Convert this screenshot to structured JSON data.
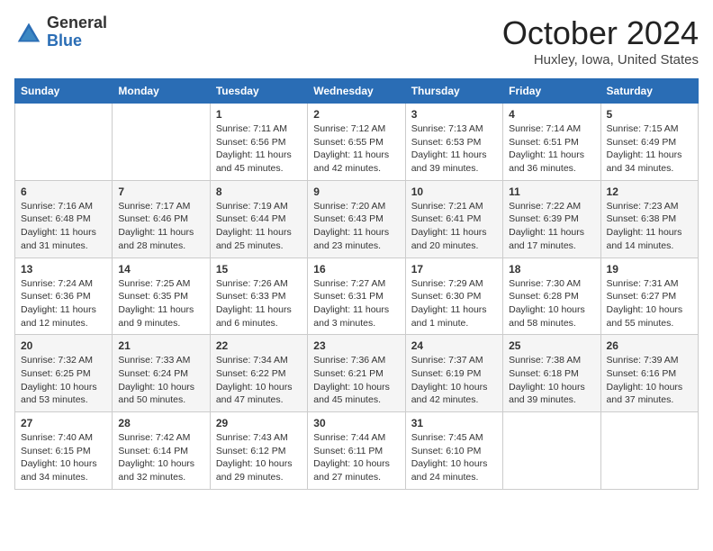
{
  "header": {
    "logo_general": "General",
    "logo_blue": "Blue",
    "month_title": "October 2024",
    "location": "Huxley, Iowa, United States"
  },
  "days_of_week": [
    "Sunday",
    "Monday",
    "Tuesday",
    "Wednesday",
    "Thursday",
    "Friday",
    "Saturday"
  ],
  "weeks": [
    [
      {
        "day": "",
        "info": ""
      },
      {
        "day": "",
        "info": ""
      },
      {
        "day": "1",
        "info": "Sunrise: 7:11 AM\nSunset: 6:56 PM\nDaylight: 11 hours and 45 minutes."
      },
      {
        "day": "2",
        "info": "Sunrise: 7:12 AM\nSunset: 6:55 PM\nDaylight: 11 hours and 42 minutes."
      },
      {
        "day": "3",
        "info": "Sunrise: 7:13 AM\nSunset: 6:53 PM\nDaylight: 11 hours and 39 minutes."
      },
      {
        "day": "4",
        "info": "Sunrise: 7:14 AM\nSunset: 6:51 PM\nDaylight: 11 hours and 36 minutes."
      },
      {
        "day": "5",
        "info": "Sunrise: 7:15 AM\nSunset: 6:49 PM\nDaylight: 11 hours and 34 minutes."
      }
    ],
    [
      {
        "day": "6",
        "info": "Sunrise: 7:16 AM\nSunset: 6:48 PM\nDaylight: 11 hours and 31 minutes."
      },
      {
        "day": "7",
        "info": "Sunrise: 7:17 AM\nSunset: 6:46 PM\nDaylight: 11 hours and 28 minutes."
      },
      {
        "day": "8",
        "info": "Sunrise: 7:19 AM\nSunset: 6:44 PM\nDaylight: 11 hours and 25 minutes."
      },
      {
        "day": "9",
        "info": "Sunrise: 7:20 AM\nSunset: 6:43 PM\nDaylight: 11 hours and 23 minutes."
      },
      {
        "day": "10",
        "info": "Sunrise: 7:21 AM\nSunset: 6:41 PM\nDaylight: 11 hours and 20 minutes."
      },
      {
        "day": "11",
        "info": "Sunrise: 7:22 AM\nSunset: 6:39 PM\nDaylight: 11 hours and 17 minutes."
      },
      {
        "day": "12",
        "info": "Sunrise: 7:23 AM\nSunset: 6:38 PM\nDaylight: 11 hours and 14 minutes."
      }
    ],
    [
      {
        "day": "13",
        "info": "Sunrise: 7:24 AM\nSunset: 6:36 PM\nDaylight: 11 hours and 12 minutes."
      },
      {
        "day": "14",
        "info": "Sunrise: 7:25 AM\nSunset: 6:35 PM\nDaylight: 11 hours and 9 minutes."
      },
      {
        "day": "15",
        "info": "Sunrise: 7:26 AM\nSunset: 6:33 PM\nDaylight: 11 hours and 6 minutes."
      },
      {
        "day": "16",
        "info": "Sunrise: 7:27 AM\nSunset: 6:31 PM\nDaylight: 11 hours and 3 minutes."
      },
      {
        "day": "17",
        "info": "Sunrise: 7:29 AM\nSunset: 6:30 PM\nDaylight: 11 hours and 1 minute."
      },
      {
        "day": "18",
        "info": "Sunrise: 7:30 AM\nSunset: 6:28 PM\nDaylight: 10 hours and 58 minutes."
      },
      {
        "day": "19",
        "info": "Sunrise: 7:31 AM\nSunset: 6:27 PM\nDaylight: 10 hours and 55 minutes."
      }
    ],
    [
      {
        "day": "20",
        "info": "Sunrise: 7:32 AM\nSunset: 6:25 PM\nDaylight: 10 hours and 53 minutes."
      },
      {
        "day": "21",
        "info": "Sunrise: 7:33 AM\nSunset: 6:24 PM\nDaylight: 10 hours and 50 minutes."
      },
      {
        "day": "22",
        "info": "Sunrise: 7:34 AM\nSunset: 6:22 PM\nDaylight: 10 hours and 47 minutes."
      },
      {
        "day": "23",
        "info": "Sunrise: 7:36 AM\nSunset: 6:21 PM\nDaylight: 10 hours and 45 minutes."
      },
      {
        "day": "24",
        "info": "Sunrise: 7:37 AM\nSunset: 6:19 PM\nDaylight: 10 hours and 42 minutes."
      },
      {
        "day": "25",
        "info": "Sunrise: 7:38 AM\nSunset: 6:18 PM\nDaylight: 10 hours and 39 minutes."
      },
      {
        "day": "26",
        "info": "Sunrise: 7:39 AM\nSunset: 6:16 PM\nDaylight: 10 hours and 37 minutes."
      }
    ],
    [
      {
        "day": "27",
        "info": "Sunrise: 7:40 AM\nSunset: 6:15 PM\nDaylight: 10 hours and 34 minutes."
      },
      {
        "day": "28",
        "info": "Sunrise: 7:42 AM\nSunset: 6:14 PM\nDaylight: 10 hours and 32 minutes."
      },
      {
        "day": "29",
        "info": "Sunrise: 7:43 AM\nSunset: 6:12 PM\nDaylight: 10 hours and 29 minutes."
      },
      {
        "day": "30",
        "info": "Sunrise: 7:44 AM\nSunset: 6:11 PM\nDaylight: 10 hours and 27 minutes."
      },
      {
        "day": "31",
        "info": "Sunrise: 7:45 AM\nSunset: 6:10 PM\nDaylight: 10 hours and 24 minutes."
      },
      {
        "day": "",
        "info": ""
      },
      {
        "day": "",
        "info": ""
      }
    ]
  ]
}
